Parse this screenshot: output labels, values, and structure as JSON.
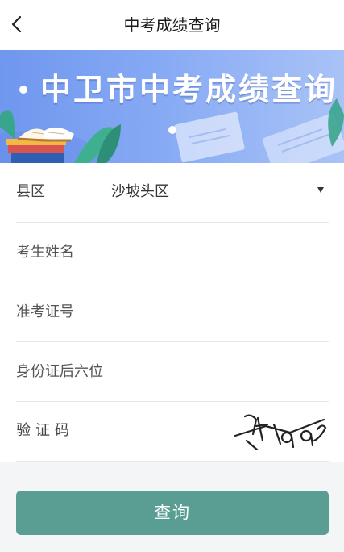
{
  "header": {
    "title": "中考成绩查询",
    "back_icon": "chevron-left-icon"
  },
  "banner": {
    "title": "中卫市中考成绩查询"
  },
  "form": {
    "district": {
      "label": "县区",
      "value": "沙坡头区",
      "arrow_icon": "caret-down-icon"
    },
    "name": {
      "placeholder": "考生姓名",
      "value": ""
    },
    "exam_number": {
      "placeholder": "准考证号",
      "value": ""
    },
    "id_last_six": {
      "placeholder": "身份证后六位",
      "value": ""
    },
    "captcha": {
      "label": "验证码",
      "value": ""
    }
  },
  "actions": {
    "query_label": "查询"
  },
  "colors": {
    "primary_button": "#5a9e93",
    "banner_blue": "#7a9ff0",
    "background": "#f4f5f7"
  }
}
